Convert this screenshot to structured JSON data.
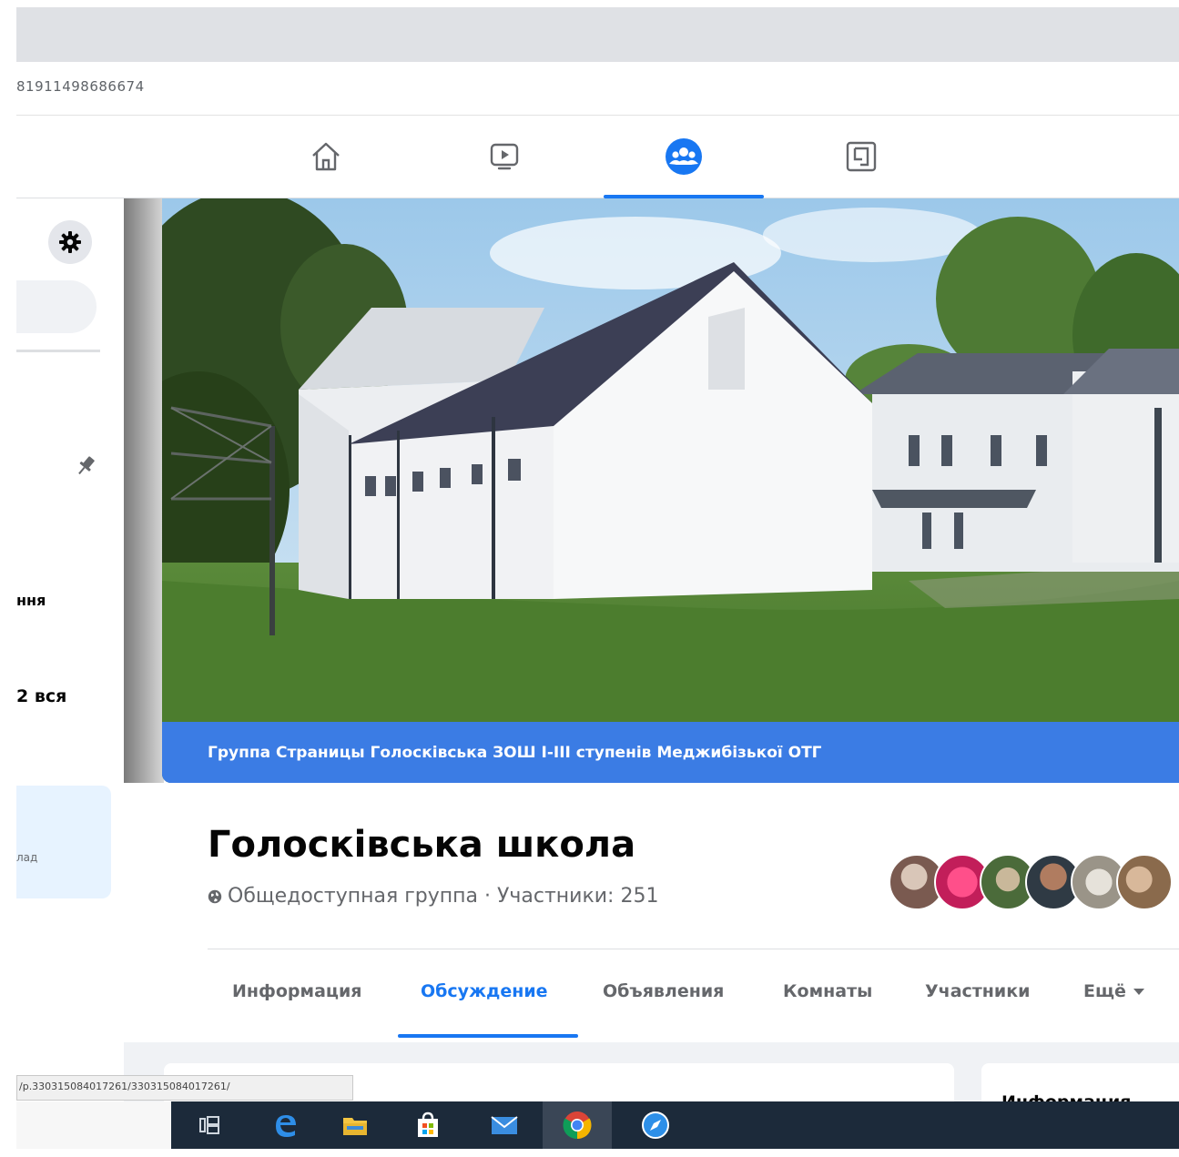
{
  "browser": {
    "url_fragment": "81911498686674"
  },
  "sidebar": {
    "labels": [
      "ння",
      "2 вся"
    ],
    "card_text": "лад"
  },
  "cover": {
    "banner_text": "Группа Страницы Голосківська ЗОШ І-ІІІ ступенів Меджибізької ОТГ"
  },
  "group": {
    "title": "Голосківська школа",
    "subtitle": "Общедоступная группа · Участники: 251"
  },
  "tabs": [
    {
      "label": "Информация"
    },
    {
      "label": "Обсуждение"
    },
    {
      "label": "Объявления"
    },
    {
      "label": "Комнаты"
    },
    {
      "label": "Участники"
    },
    {
      "label": "Ещё"
    }
  ],
  "right_card": {
    "title": "Информация"
  },
  "status_bar": {
    "url": "/p.330315084017261/330315084017261/"
  },
  "colors": {
    "accent": "#1877f2",
    "banner": "#3b7ce4",
    "taskbar": "#1c2a3a"
  },
  "icons": [
    "home-icon",
    "watch-icon",
    "groups-icon",
    "gaming-icon",
    "gear-icon",
    "pin-icon",
    "globe-icon",
    "task-view-icon",
    "edge-icon",
    "file-explorer-icon",
    "store-icon",
    "mail-icon",
    "chrome-icon",
    "safari-like-icon"
  ]
}
